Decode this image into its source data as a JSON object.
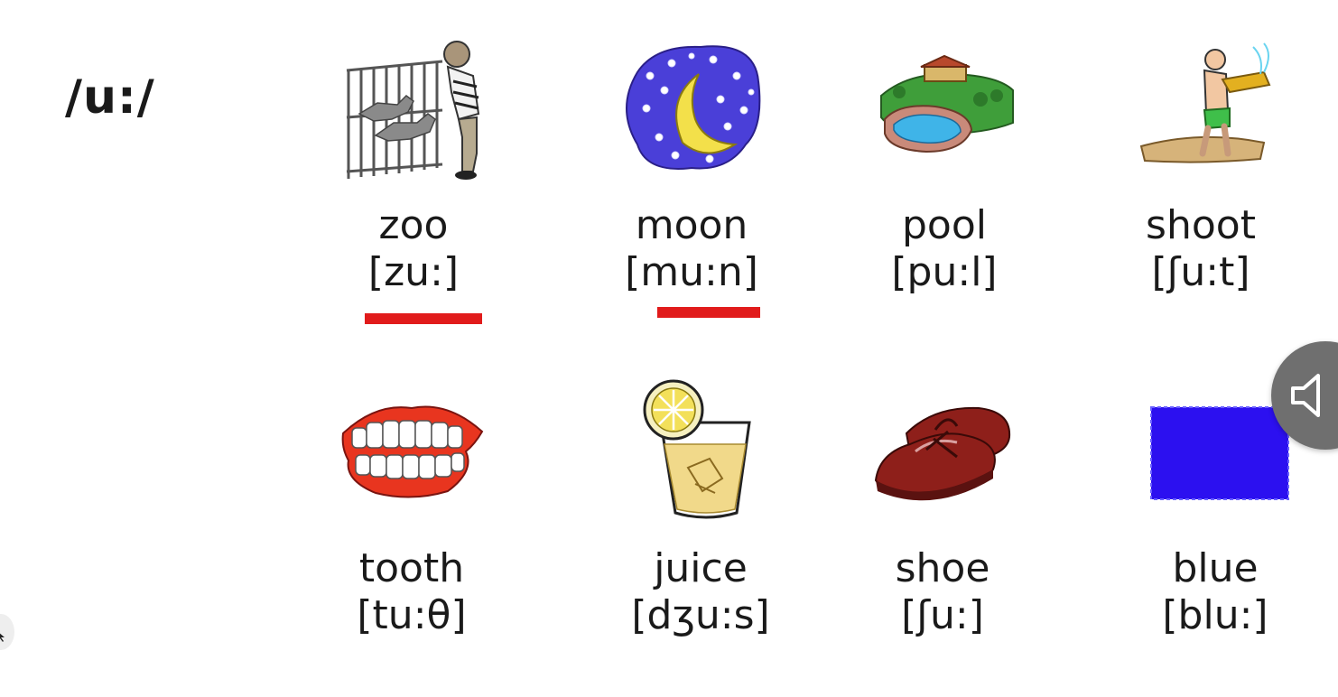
{
  "phoneme": "/u:/",
  "words": [
    {
      "word": "zoo",
      "ipa": "[zu:]",
      "icon": "zoo-boy-icon",
      "underlined": true
    },
    {
      "word": "moon",
      "ipa": "[mu:n]",
      "icon": "moon-stars-icon",
      "underlined": true
    },
    {
      "word": "pool",
      "ipa": "[pu:l]",
      "icon": "swimming-pool-icon",
      "underlined": false
    },
    {
      "word": "shoot",
      "ipa": "[ʃu:t]",
      "icon": "water-gun-boy-icon",
      "underlined": false
    },
    {
      "word": "tooth",
      "ipa": "[tu:θ]",
      "icon": "teeth-icon",
      "underlined": false
    },
    {
      "word": "juice",
      "ipa": "[dʒu:s]",
      "icon": "lemon-juice-glass-icon",
      "underlined": false
    },
    {
      "word": "shoe",
      "ipa": "[ʃu:]",
      "icon": "shoes-icon",
      "underlined": false
    },
    {
      "word": "blue",
      "ipa": "[blu:]",
      "icon": "blue-square-icon",
      "underlined": false
    }
  ],
  "colors": {
    "underline": "#e11b1b",
    "blue_square": "#2c10f0",
    "moon_background": "#4a3fd8",
    "shoe": "#8e1f1a",
    "gums": "#e8351f",
    "sound_button": "#6f6f6f"
  },
  "controls": {
    "sound_icon": "speaker-icon"
  }
}
